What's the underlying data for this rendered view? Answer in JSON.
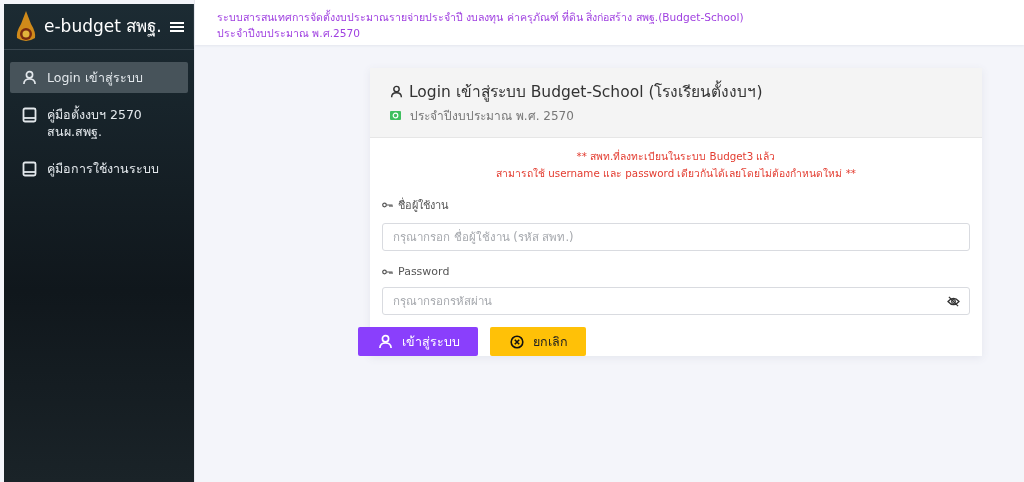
{
  "sidebar": {
    "brand": "e-budget สพฐ.",
    "items": [
      {
        "label": "Login เข้าสู่ระบบ",
        "kind": "user",
        "selected": true
      },
      {
        "label": "คู่มือตั้งงบฯ 2570 สนผ.สพฐ.",
        "kind": "book",
        "selected": false
      },
      {
        "label": "คู่มือการใช้งานระบบ",
        "kind": "book",
        "selected": false
      }
    ]
  },
  "header": {
    "lines": [
      "ระบบสารสนเทศการจัดตั้งงบประมาณรายจ่ายประจำปี งบลงทุน ค่าครุภัณฑ์ ที่ดิน สิ่งก่อสร้าง สพฐ.(Budget-School)",
      "ประจำปีงบประมาณ พ.ศ.2570"
    ]
  },
  "login": {
    "title": "Login เข้าสู่ระบบ Budget-School (โรงเรียนตั้งงบฯ)",
    "subtitle": "ประจำปีงบประมาณ พ.ศ. 2570",
    "notice": [
      "** สพท.ที่ลงทะเบียนในระบบ Budget3 แล้ว",
      "สามารถใช้ username และ password เดียวกันได้เลยโดยไม่ต้องกำหนดใหม่ **"
    ],
    "fields": [
      {
        "label": "ชื่อผู้ใช้งาน",
        "placeholder": "กรุณากรอก ชื่อผู้ใช้งาน (รหัส สพท.)",
        "kind": "text"
      },
      {
        "label": "Password",
        "placeholder": "กรุณากรอกรหัสผ่าน",
        "kind": "password"
      }
    ],
    "buttons": [
      {
        "label": "เข้าสู่ระบบ",
        "kind": "submit"
      },
      {
        "label": "ยกเลิก",
        "kind": "cancel"
      }
    ]
  }
}
